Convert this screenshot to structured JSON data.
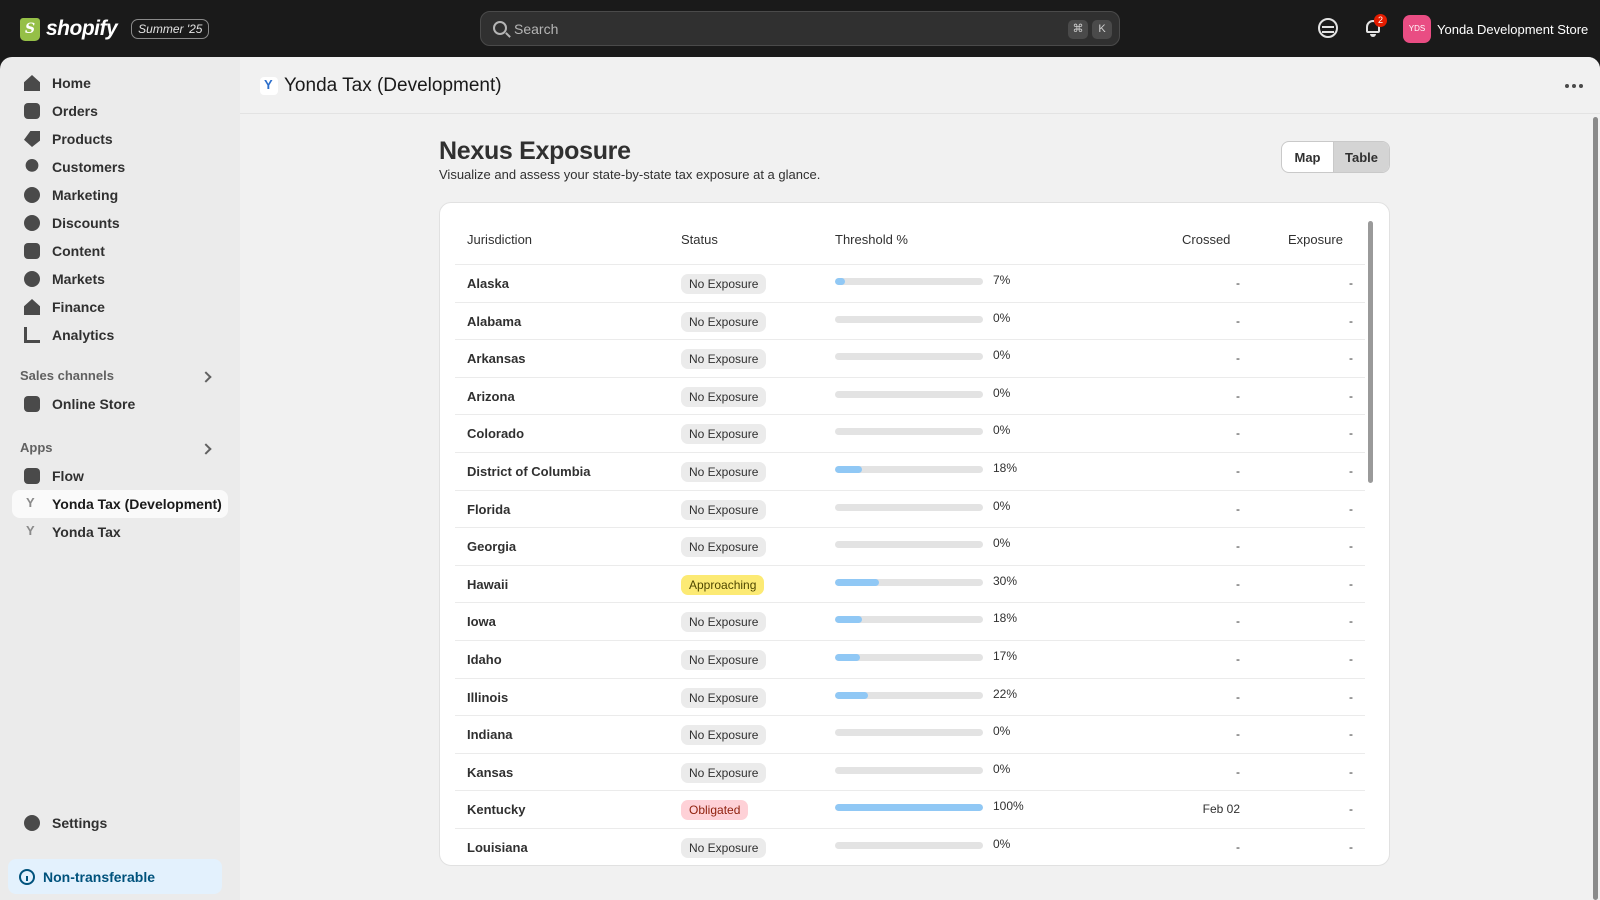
{
  "topbar": {
    "logo_text": "shopify",
    "edition_badge": "Summer '25",
    "search_placeholder": "Search",
    "shortcut_keys": [
      "⌘",
      "K"
    ],
    "notification_count": "2",
    "store_initials": "YDS",
    "store_name": "Yonda Development Store"
  },
  "sidebar": {
    "items": [
      {
        "label": "Home",
        "icon": "home-icon"
      },
      {
        "label": "Orders",
        "icon": "orders-icon"
      },
      {
        "label": "Products",
        "icon": "tag-icon"
      },
      {
        "label": "Customers",
        "icon": "person-icon"
      },
      {
        "label": "Marketing",
        "icon": "target-icon"
      },
      {
        "label": "Discounts",
        "icon": "discount-icon"
      },
      {
        "label": "Content",
        "icon": "content-icon"
      },
      {
        "label": "Markets",
        "icon": "globe-icon"
      },
      {
        "label": "Finance",
        "icon": "bank-icon"
      },
      {
        "label": "Analytics",
        "icon": "bar-chart-icon"
      }
    ],
    "sales_channels_title": "Sales channels",
    "sales_channels": [
      {
        "label": "Online Store",
        "icon": "store-icon"
      }
    ],
    "apps_title": "Apps",
    "apps": [
      {
        "label": "Flow",
        "icon": "flow-icon"
      },
      {
        "label": "Yonda Tax (Development)",
        "icon": "yonda-icon",
        "active": true
      },
      {
        "label": "Yonda Tax",
        "icon": "yonda-icon"
      }
    ],
    "settings_label": "Settings",
    "footer_label": "Non-transferable"
  },
  "app": {
    "title": "Yonda Tax (Development)"
  },
  "page": {
    "title": "Nexus Exposure",
    "subtitle": "Visualize and assess your state-by-state tax exposure at a glance.",
    "view_toggle": {
      "map": "Map",
      "table": "Table",
      "selected": "Table"
    }
  },
  "table": {
    "headers": {
      "jurisdiction": "Jurisdiction",
      "status": "Status",
      "threshold": "Threshold %",
      "crossed": "Crossed",
      "exposure": "Exposure"
    },
    "rows": [
      {
        "state": "Alaska",
        "status": "No Exposure",
        "status_type": "none",
        "pct": 7,
        "pct_label": "7%",
        "crossed": "-",
        "exposure": "-"
      },
      {
        "state": "Alabama",
        "status": "No Exposure",
        "status_type": "none",
        "pct": 0,
        "pct_label": "0%",
        "crossed": "-",
        "exposure": "-"
      },
      {
        "state": "Arkansas",
        "status": "No Exposure",
        "status_type": "none",
        "pct": 0,
        "pct_label": "0%",
        "crossed": "-",
        "exposure": "-"
      },
      {
        "state": "Arizona",
        "status": "No Exposure",
        "status_type": "none",
        "pct": 0,
        "pct_label": "0%",
        "crossed": "-",
        "exposure": "-"
      },
      {
        "state": "Colorado",
        "status": "No Exposure",
        "status_type": "none",
        "pct": 0,
        "pct_label": "0%",
        "crossed": "-",
        "exposure": "-"
      },
      {
        "state": "District of Columbia",
        "status": "No Exposure",
        "status_type": "none",
        "pct": 18,
        "pct_label": "18%",
        "crossed": "-",
        "exposure": "-"
      },
      {
        "state": "Florida",
        "status": "No Exposure",
        "status_type": "none",
        "pct": 0,
        "pct_label": "0%",
        "crossed": "-",
        "exposure": "-"
      },
      {
        "state": "Georgia",
        "status": "No Exposure",
        "status_type": "none",
        "pct": 0,
        "pct_label": "0%",
        "crossed": "-",
        "exposure": "-"
      },
      {
        "state": "Hawaii",
        "status": "Approaching",
        "status_type": "approaching",
        "pct": 30,
        "pct_label": "30%",
        "crossed": "-",
        "exposure": "-"
      },
      {
        "state": "Iowa",
        "status": "No Exposure",
        "status_type": "none",
        "pct": 18,
        "pct_label": "18%",
        "crossed": "-",
        "exposure": "-"
      },
      {
        "state": "Idaho",
        "status": "No Exposure",
        "status_type": "none",
        "pct": 17,
        "pct_label": "17%",
        "crossed": "-",
        "exposure": "-"
      },
      {
        "state": "Illinois",
        "status": "No Exposure",
        "status_type": "none",
        "pct": 22,
        "pct_label": "22%",
        "crossed": "-",
        "exposure": "-"
      },
      {
        "state": "Indiana",
        "status": "No Exposure",
        "status_type": "none",
        "pct": 0,
        "pct_label": "0%",
        "crossed": "-",
        "exposure": "-"
      },
      {
        "state": "Kansas",
        "status": "No Exposure",
        "status_type": "none",
        "pct": 0,
        "pct_label": "0%",
        "crossed": "-",
        "exposure": "-"
      },
      {
        "state": "Kentucky",
        "status": "Obligated",
        "status_type": "obligated",
        "pct": 100,
        "pct_label": "100%",
        "crossed": "Feb 02",
        "exposure": "-"
      },
      {
        "state": "Louisiana",
        "status": "No Exposure",
        "status_type": "none",
        "pct": 0,
        "pct_label": "0%",
        "crossed": "-",
        "exposure": "-"
      }
    ]
  },
  "colors": {
    "bar_fill": "#90c8f5",
    "approaching": "#fcea74",
    "obligated": "#fed1d7",
    "store_avatar": "#e94d83"
  }
}
